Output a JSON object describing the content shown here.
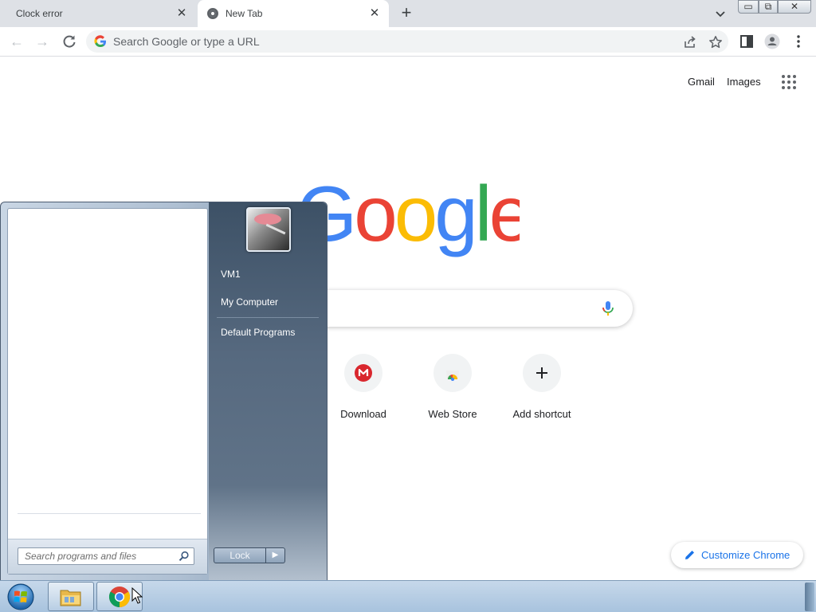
{
  "browser": {
    "tabs": [
      {
        "title": "Clock error",
        "active": false
      },
      {
        "title": "New Tab",
        "active": true
      }
    ],
    "omnibox_placeholder": "Search Google or type a URL"
  },
  "ntp": {
    "header_links": [
      "Gmail",
      "Images"
    ],
    "shortcuts": [
      {
        "label": "Download",
        "icon": "mega-icon"
      },
      {
        "label": "Web Store",
        "icon": "chrome-web-store-icon"
      },
      {
        "label": "Add shortcut",
        "icon": "plus-icon"
      }
    ],
    "customize_label": "Customize Chrome"
  },
  "start_menu": {
    "search_placeholder": "Search programs and files",
    "right_items": [
      "VM1",
      "My Computer",
      "Default Programs"
    ],
    "lock_label": "Lock"
  },
  "taskbar": {
    "pinned": [
      "windows-explorer",
      "google-chrome"
    ]
  },
  "colors": {
    "google_blue": "#4285f4",
    "google_red": "#ea4335",
    "google_yellow": "#fbbc05",
    "google_green": "#34a853",
    "link_blue": "#1a73e8"
  }
}
